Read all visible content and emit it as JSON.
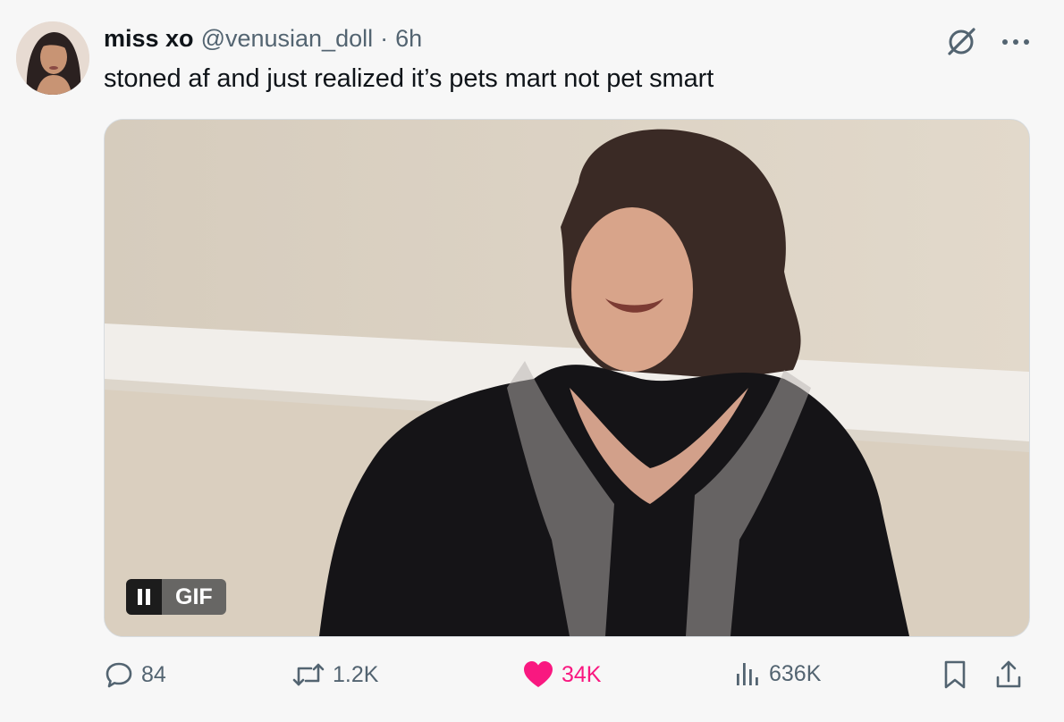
{
  "tweet": {
    "author_name": "miss xo",
    "author_handle": "@venusian_doll",
    "separator": "·",
    "time": "6h",
    "text": "stoned af and just realized it’s pets mart not pet smart",
    "media": {
      "badge": "GIF",
      "pause_icon": "pause-icon"
    }
  },
  "actions": {
    "reply_count": "84",
    "repost_count": "1.2K",
    "like_count": "34K",
    "view_count": "636K"
  },
  "colors": {
    "like": "#f91880",
    "muted": "#536471",
    "text": "#0f1419"
  }
}
